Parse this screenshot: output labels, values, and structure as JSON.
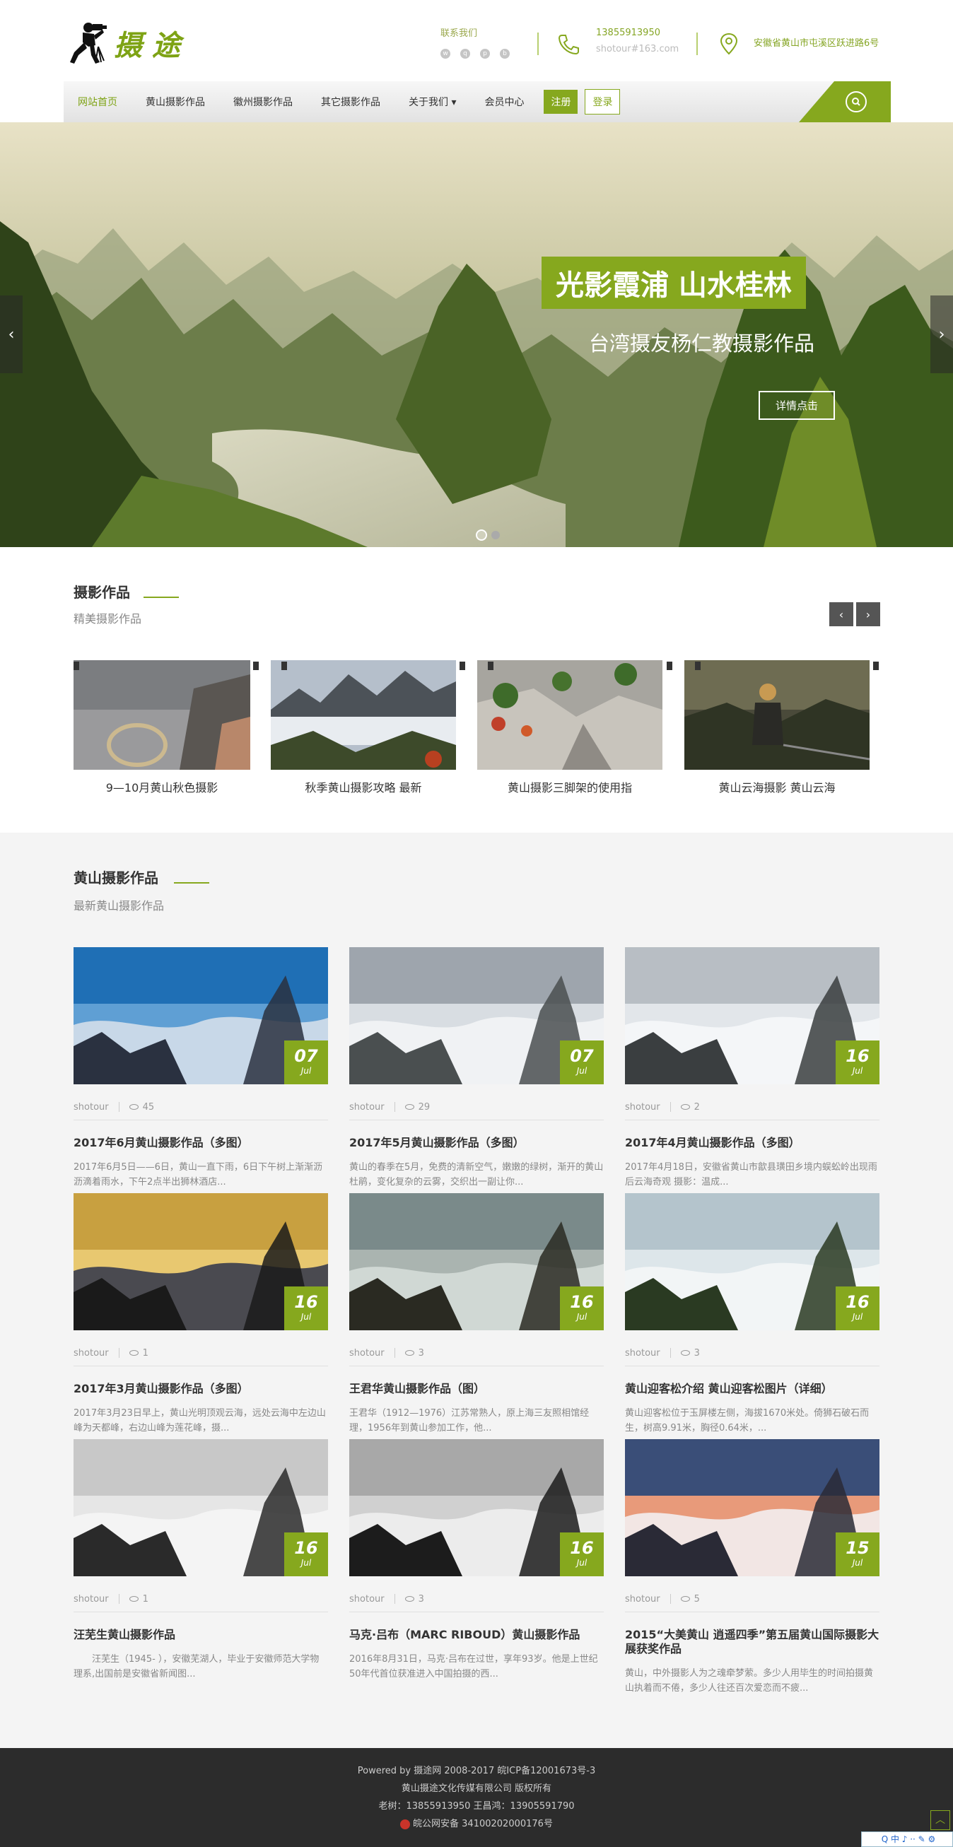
{
  "header": {
    "logo_text": "摄途",
    "contact_title": "联系我们",
    "phone": "13855913950",
    "email": "shotour#163.com",
    "address": "安徽省黄山市屯溪区跃进路6号",
    "social_icons": [
      "wechat-icon",
      "qq-icon",
      "pinterest-icon",
      "weibo-icon"
    ]
  },
  "nav": {
    "items": [
      "网站首页",
      "黄山摄影作品",
      "徽州摄影作品",
      "其它摄影作品",
      "关于我们 ▾",
      "会员中心"
    ],
    "register": "注册",
    "login": "登录"
  },
  "banner": {
    "title": "光影霞浦 山水桂林",
    "subtitle": "台湾摄友杨仁教摄影作品",
    "button": "详情点击",
    "prev": "‹",
    "next": "›"
  },
  "works": {
    "title": "摄影作品",
    "subtitle": "精美摄影作品",
    "prev": "‹",
    "next": "›",
    "items": [
      {
        "caption": "9—10月黄山秋色摄影"
      },
      {
        "caption": "秋季黄山摄影攻略 最新"
      },
      {
        "caption": "黄山摄影三脚架的使用指"
      },
      {
        "caption": "黄山云海摄影 黄山云海"
      }
    ]
  },
  "huangshan": {
    "title": "黄山摄影作品",
    "subtitle": "最新黄山摄影作品",
    "cards": [
      {
        "day": "07",
        "month": "Jul",
        "author": "shotour",
        "views": "45",
        "title": "2017年6月黄山摄影作品（多图）",
        "desc": "2017年6月5日——6日，黄山一直下雨，6日下午树上渐渐沥沥滴着雨水，下午2点半出狮林酒店..."
      },
      {
        "day": "07",
        "month": "Jul",
        "author": "shotour",
        "views": "29",
        "title": "2017年5月黄山摄影作品（多图）",
        "desc": "黄山的春季在5月，免费的清新空气，嫩嫩的绿树，渐开的黄山杜鹃，变化复杂的云雾，交织出一副让你..."
      },
      {
        "day": "16",
        "month": "Jul",
        "author": "shotour",
        "views": "2",
        "title": "2017年4月黄山摄影作品（多图）",
        "desc": "2017年4月18日，安徽省黄山市歙县璜田乡境内蜈蚣岭出现雨后云海奇观 摄影：温成..."
      },
      {
        "day": "16",
        "month": "Jul",
        "author": "shotour",
        "views": "1",
        "title": "2017年3月黄山摄影作品（多图）",
        "desc": "2017年3月23日早上，黄山光明顶观云海，远处云海中左边山峰为天都峰，右边山峰为莲花峰，摄..."
      },
      {
        "day": "16",
        "month": "Jul",
        "author": "shotour",
        "views": "3",
        "title": "王君华黄山摄影作品（图）",
        "desc": "王君华（1912—1976）江苏常熟人，原上海三友照相馆经理，1956年到黄山参加工作，他..."
      },
      {
        "day": "16",
        "month": "Jul",
        "author": "shotour",
        "views": "3",
        "title": "黄山迎客松介绍 黄山迎客松图片（详细）",
        "desc": "黄山迎客松位于玉屏楼左侧，海拔1670米处。倚狮石破石而生，树高9.91米，胸径0.64米，..."
      },
      {
        "day": "16",
        "month": "Jul",
        "author": "shotour",
        "views": "1",
        "title": "汪芜生黄山摄影作品",
        "desc": "　　汪芜生（1945- ），安徽芜湖人，毕业于安徽师范大学物理系,出国前是安徽省新闻图..."
      },
      {
        "day": "16",
        "month": "Jul",
        "author": "shotour",
        "views": "3",
        "title": "马克·吕布（MARC RIBOUD）黄山摄影作品",
        "desc": "2016年8月31日，马克·吕布在过世，享年93岁。他是上世纪50年代首位获准进入中国拍摄的西..."
      },
      {
        "day": "15",
        "month": "Jul",
        "author": "shotour",
        "views": "5",
        "title": "2015“大美黄山 逍遥四季”第五届黄山国际摄影大展获奖作品",
        "desc": "黄山，中外摄影人为之魂牵梦萦。多少人用毕生的时间拍摄黄山执着而不倦，多少人往还百次爱恋而不疲..."
      }
    ]
  },
  "footer": {
    "line1": "Powered by 摄途网 2008-2017 皖ICP备12001673号-3",
    "line2": "黄山摄途文化传媒有限公司 版权所有",
    "line3": "老树：13855913950 王昌鸿：13905591790",
    "line4": "皖公网安备 34100202000176号",
    "badge": "Q 中 ♪ ·· ✎ ⚙"
  },
  "colors": {
    "accent": "#86a81e",
    "footer_bg": "#2c2c2c",
    "section_bg": "#f4f4f4"
  }
}
